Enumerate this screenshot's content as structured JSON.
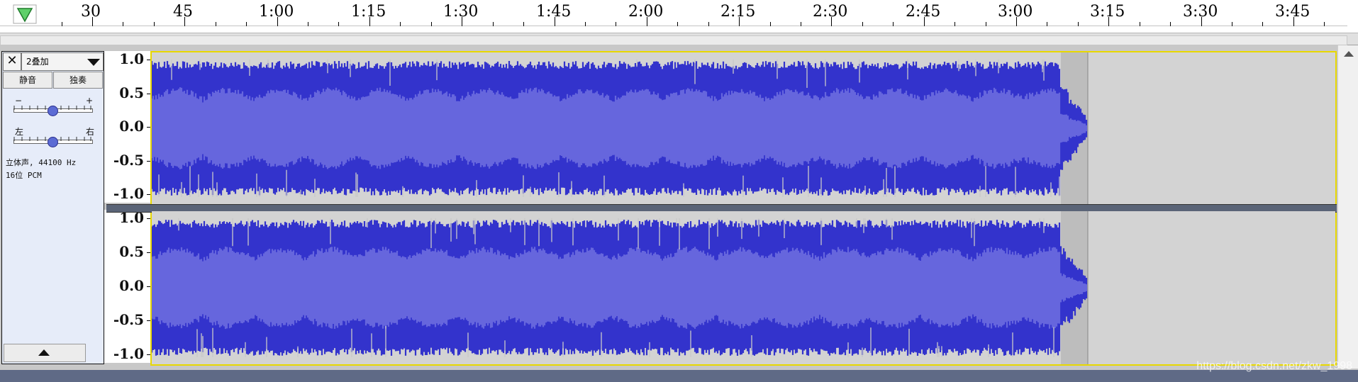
{
  "timeline": {
    "play_icon": "play-head-triangle-icon",
    "labels": [
      "30",
      "45",
      "1:00",
      "1:15",
      "1:30",
      "1:45",
      "2:00",
      "2:15",
      "2:30",
      "2:45",
      "3:00",
      "3:15",
      "3:30",
      "3:45"
    ]
  },
  "track": {
    "close_icon": "close-icon",
    "name": "2叠加",
    "menu_icon": "dropdown-arrow-icon",
    "mute_label": "静音",
    "solo_label": "独奏",
    "gain": {
      "min_label": "−",
      "max_label": "+",
      "value_fraction": 0.5
    },
    "pan": {
      "left_label": "左",
      "right_label": "右",
      "value_fraction": 0.5
    },
    "info_line1": "立体声, 44100 Hz",
    "info_line2": "16位 PCM",
    "collapse_icon": "collapse-up-icon"
  },
  "scale": {
    "labels": [
      "1.0",
      "0.5",
      "0.0",
      "-0.5",
      "-1.0"
    ]
  },
  "waveform": {
    "channels": 2,
    "audio_end_time": "3:07",
    "colors": {
      "wave_dark": "#3333cc",
      "wave_rms": "#6666dd",
      "background": "#d3d3d3",
      "selection_bg": "#bdbdbd",
      "clip_border": "#e8d800"
    }
  },
  "watermark": "https://blog.csdn.net/zkw_1998"
}
